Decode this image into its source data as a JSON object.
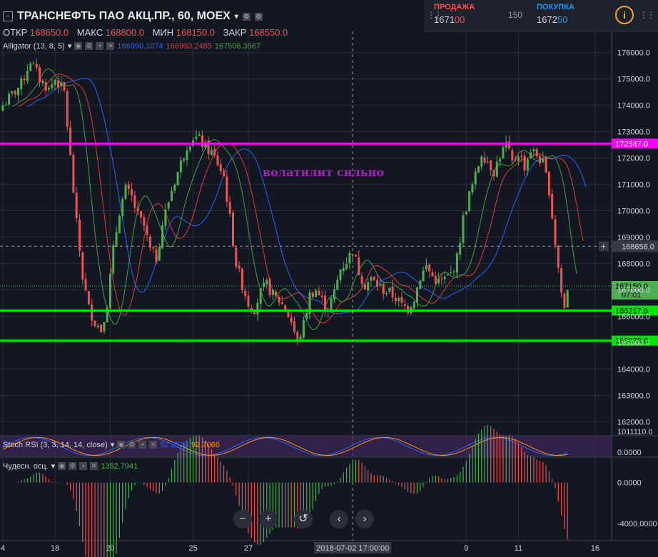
{
  "header": {
    "title": "ТРАНСНЕФТЬ ПАО АКЦ.ПР., 60, MOEX",
    "ohlc": [
      {
        "label": "ОТКР",
        "value": "168650.0"
      },
      {
        "label": "МАКС",
        "value": "168800.0"
      },
      {
        "label": "МИН",
        "value": "168150.0"
      },
      {
        "label": "ЗАКР",
        "value": "168550.0"
      }
    ]
  },
  "trade": {
    "sell_label": "ПРОДАЖА",
    "sell_price_main": "1671",
    "sell_price_tail": "00",
    "spread": "150",
    "buy_label": "ПОКУПКА",
    "buy_price_main": "1672",
    "buy_price_tail": "50",
    "info_glyph": "i"
  },
  "indicators": {
    "alligator": {
      "label": "Alligator (13, 8, 5)",
      "v1": "166990.1074",
      "v2": "166993.2485",
      "v3": "167508.3567"
    },
    "stoch": {
      "label": "Stoch RSI (3, 3, 14, 14, close)",
      "v1": "92.2523",
      "v2": "92.7066"
    },
    "ao": {
      "label": "Чудесн. осц.",
      "v1": "1352.7941"
    }
  },
  "annotation": "волатилит сильно",
  "nav": {
    "zoom_out": "−",
    "zoom_in": "+",
    "reset": "↺",
    "prev": "‹",
    "next": "›"
  },
  "colors": {
    "background": "#131722",
    "up": "#4caf50",
    "down": "#ef5350",
    "jaw": "#2962ff",
    "teeth": "#e53935",
    "lips": "#43a047",
    "level_magenta": "#ff00ff",
    "level_green": "#00e600",
    "annotation": "#9c27b0"
  },
  "chart_data": {
    "type": "candlestick",
    "ylim": [
      161500,
      176800
    ],
    "price_ticks": [
      "176000.0",
      "175000.0",
      "174000.0",
      "173000.0",
      "172000.0",
      "171000.0",
      "170000.0",
      "169000.0",
      "168000.0",
      "167000.0",
      "166000.0",
      "165000.0",
      "164000.0",
      "163000.0",
      "162000.0"
    ],
    "x_ticks": [
      "4",
      "18",
      "20",
      "25",
      "27",
      "9",
      "11",
      "16"
    ],
    "x_tick_candle": [
      0,
      17,
      35,
      62,
      80,
      151,
      168,
      193
    ],
    "cursor_label": "2018-07-02 17:00:00",
    "cursor_candle": 114,
    "cursor_price": 168656.0,
    "cursor_price_label": "168656.0",
    "levels": [
      {
        "price": 172547.0,
        "label": "172547.0",
        "color": "#ff00ff"
      },
      {
        "price": 166217.0,
        "label": "166217.0",
        "color": "#00e600"
      },
      {
        "price": 165079.0,
        "label": "165079.0",
        "color": "#00e600"
      }
    ],
    "last_price": {
      "price": 167150.0,
      "label": "167150.0",
      "countdown": "07:01"
    },
    "keypoints": [
      [
        0,
        174000
      ],
      [
        3,
        174400
      ],
      [
        6,
        174800
      ],
      [
        9,
        175700
      ],
      [
        12,
        175000
      ],
      [
        15,
        174600
      ],
      [
        17,
        175000
      ],
      [
        20,
        174500
      ],
      [
        22,
        172000
      ],
      [
        24,
        169500
      ],
      [
        26,
        167500
      ],
      [
        28,
        166300
      ],
      [
        30,
        165800
      ],
      [
        32,
        165500
      ],
      [
        34,
        166500
      ],
      [
        36,
        168500
      ],
      [
        38,
        170000
      ],
      [
        40,
        170800
      ],
      [
        42,
        170500
      ],
      [
        44,
        169800
      ],
      [
        46,
        169400
      ],
      [
        48,
        168500
      ],
      [
        50,
        168200
      ],
      [
        52,
        169500
      ],
      [
        55,
        170800
      ],
      [
        58,
        171800
      ],
      [
        60,
        172500
      ],
      [
        62,
        172800
      ],
      [
        64,
        172700
      ],
      [
        66,
        172400
      ],
      [
        68,
        172200
      ],
      [
        70,
        171800
      ],
      [
        72,
        171300
      ],
      [
        74,
        169700
      ],
      [
        76,
        168000
      ],
      [
        78,
        167200
      ],
      [
        80,
        166500
      ],
      [
        82,
        166300
      ],
      [
        84,
        166900
      ],
      [
        86,
        167200
      ],
      [
        88,
        166800
      ],
      [
        90,
        166600
      ],
      [
        92,
        166300
      ],
      [
        94,
        165800
      ],
      [
        96,
        165000
      ],
      [
        98,
        165700
      ],
      [
        100,
        166800
      ],
      [
        102,
        167000
      ],
      [
        104,
        166600
      ],
      [
        106,
        166300
      ],
      [
        108,
        166900
      ],
      [
        110,
        167800
      ],
      [
        112,
        168100
      ],
      [
        114,
        168500
      ],
      [
        116,
        167700
      ],
      [
        118,
        167200
      ],
      [
        120,
        167400
      ],
      [
        122,
        167200
      ],
      [
        124,
        167000
      ],
      [
        126,
        166900
      ],
      [
        128,
        166700
      ],
      [
        130,
        166400
      ],
      [
        132,
        166300
      ],
      [
        134,
        166700
      ],
      [
        136,
        167500
      ],
      [
        138,
        167900
      ],
      [
        140,
        167500
      ],
      [
        142,
        167300
      ],
      [
        144,
        167400
      ],
      [
        146,
        167600
      ],
      [
        148,
        168200
      ],
      [
        150,
        169700
      ],
      [
        152,
        170600
      ],
      [
        154,
        171300
      ],
      [
        156,
        172200
      ],
      [
        158,
        171900
      ],
      [
        160,
        171500
      ],
      [
        162,
        172100
      ],
      [
        164,
        172500
      ],
      [
        166,
        171800
      ],
      [
        168,
        172200
      ],
      [
        170,
        171700
      ],
      [
        172,
        172300
      ],
      [
        174,
        172100
      ],
      [
        176,
        171800
      ],
      [
        178,
        170800
      ],
      [
        180,
        168800
      ],
      [
        182,
        166900
      ],
      [
        183,
        166300
      ],
      [
        184,
        167100
      ]
    ],
    "candle_count": 185,
    "stoch_ticks": [
      "0.0000"
    ],
    "stoch_ylim": [
      0,
      100
    ],
    "stoch_partial_label": "1011110.0",
    "ao_ticks": [
      "0.0000",
      "-4000.0000"
    ],
    "ao_ylim": [
      -5600,
      2400
    ]
  }
}
